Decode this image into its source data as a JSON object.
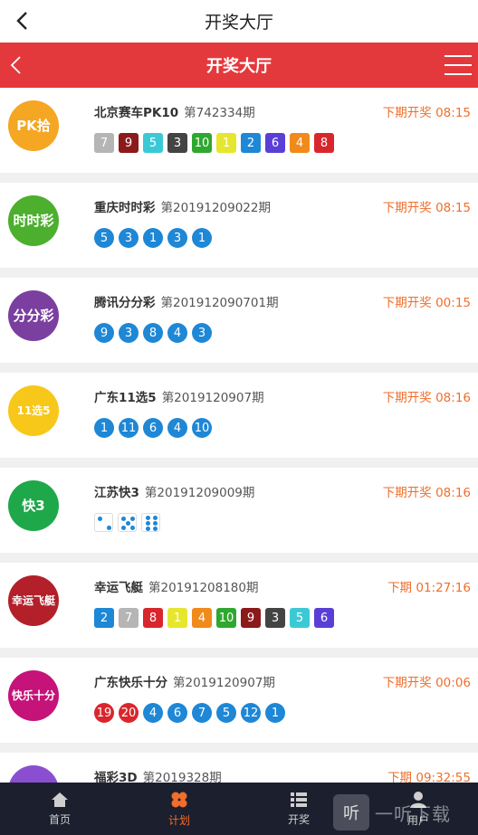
{
  "header": {
    "title": "开奖大厅"
  },
  "nav": {
    "title": "开奖大厅"
  },
  "lotteries": [
    {
      "name": "北京赛车PK10",
      "issue": "第742334期",
      "draw": "下期开奖 08:15",
      "logo_text": "PK拾",
      "logo_color": "#f5a623",
      "balls": [
        {
          "v": "7",
          "c": "#b5b5b5"
        },
        {
          "v": "9",
          "c": "#8b1a1a"
        },
        {
          "v": "5",
          "c": "#3cc9d6"
        },
        {
          "v": "3",
          "c": "#444444"
        },
        {
          "v": "10",
          "c": "#2fa82f"
        },
        {
          "v": "1",
          "c": "#e6e62e"
        },
        {
          "v": "2",
          "c": "#1e87d6"
        },
        {
          "v": "6",
          "c": "#5a3fd6"
        },
        {
          "v": "4",
          "c": "#f08a1a"
        },
        {
          "v": "8",
          "c": "#d9262c"
        }
      ]
    },
    {
      "name": "重庆时时彩",
      "issue": "第20191209022期",
      "draw": "下期开奖 08:15",
      "logo_text": "时时彩",
      "logo_color": "#4caf2e",
      "balls": [
        {
          "v": "5"
        },
        {
          "v": "3"
        },
        {
          "v": "1"
        },
        {
          "v": "3"
        },
        {
          "v": "1"
        }
      ]
    },
    {
      "name": "腾讯分分彩",
      "issue": "第201912090701期",
      "draw": "下期开奖 00:15",
      "logo_text": "分分彩",
      "logo_color": "#7b3fa0",
      "balls": [
        {
          "v": "9"
        },
        {
          "v": "3"
        },
        {
          "v": "8"
        },
        {
          "v": "4"
        },
        {
          "v": "3"
        }
      ]
    },
    {
      "name": "广东11选5",
      "issue": "第2019120907期",
      "draw": "下期开奖 08:16",
      "logo_text": "11选5",
      "logo_color": "#f7c71a",
      "balls": [
        {
          "v": "1"
        },
        {
          "v": "11"
        },
        {
          "v": "6"
        },
        {
          "v": "4"
        },
        {
          "v": "10"
        }
      ]
    },
    {
      "name": "江苏快3",
      "issue": "第20191209009期",
      "draw": "下期开奖 08:16",
      "logo_text": "快3",
      "logo_color": "#1fa84a",
      "dice": [
        2,
        5,
        6
      ]
    },
    {
      "name": "幸运飞艇",
      "issue": "第20191208180期",
      "draw": "下期 01:27:16",
      "logo_text": "幸运飞艇",
      "logo_color": "#b3202a",
      "balls": [
        {
          "v": "2",
          "c": "#1e87d6"
        },
        {
          "v": "7",
          "c": "#b5b5b5"
        },
        {
          "v": "8",
          "c": "#d9262c"
        },
        {
          "v": "1",
          "c": "#e6e62e"
        },
        {
          "v": "4",
          "c": "#f08a1a"
        },
        {
          "v": "10",
          "c": "#2fa82f"
        },
        {
          "v": "9",
          "c": "#8b1a1a"
        },
        {
          "v": "3",
          "c": "#444444"
        },
        {
          "v": "5",
          "c": "#3cc9d6"
        },
        {
          "v": "6",
          "c": "#5a3fd6"
        }
      ]
    },
    {
      "name": "广东快乐十分",
      "issue": "第2019120907期",
      "draw": "下期开奖 00:06",
      "logo_text": "快乐十分",
      "logo_color": "#c5137a",
      "balls": [
        {
          "v": "19",
          "red": true
        },
        {
          "v": "20",
          "red": true
        },
        {
          "v": "4"
        },
        {
          "v": "6"
        },
        {
          "v": "7"
        },
        {
          "v": "5"
        },
        {
          "v": "12"
        },
        {
          "v": "1"
        }
      ]
    },
    {
      "name": "福彩3D",
      "issue": "第2019328期",
      "draw": "下期 09:32:55",
      "logo_text": "福彩",
      "logo_color": "#8a4fd0",
      "balls": []
    }
  ],
  "tabs": [
    {
      "label": "首页",
      "icon": "home-icon",
      "active": false
    },
    {
      "label": "计划",
      "icon": "clover-icon",
      "active": true
    },
    {
      "label": "开奖",
      "icon": "list-icon",
      "active": false
    },
    {
      "label": "用户",
      "icon": "user-icon",
      "active": false
    }
  ],
  "watermark": {
    "box": "听",
    "text": "一听下载"
  }
}
